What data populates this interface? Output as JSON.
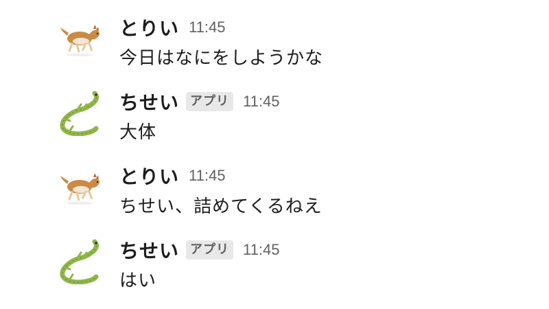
{
  "messages": [
    {
      "sender": "とりい",
      "avatar_icon": "dog-icon",
      "is_app": false,
      "badge": "",
      "time": "11:45",
      "text": "今日はなにをしようかな"
    },
    {
      "sender": "ちせい",
      "avatar_icon": "lizard-icon",
      "is_app": true,
      "badge": "アプリ",
      "time": "11:45",
      "text": "大体"
    },
    {
      "sender": "とりい",
      "avatar_icon": "dog-icon",
      "is_app": false,
      "badge": "",
      "time": "11:45",
      "text": "ちせい、詰めてくるねえ"
    },
    {
      "sender": "ちせい",
      "avatar_icon": "lizard-icon",
      "is_app": true,
      "badge": "アプリ",
      "time": "11:45",
      "text": "はい"
    }
  ],
  "colors": {
    "text": "#1d1c1d",
    "muted": "#616061",
    "badge_bg": "#e8e8e8",
    "dog": "#c98b45",
    "lizard": "#8fb74a"
  }
}
